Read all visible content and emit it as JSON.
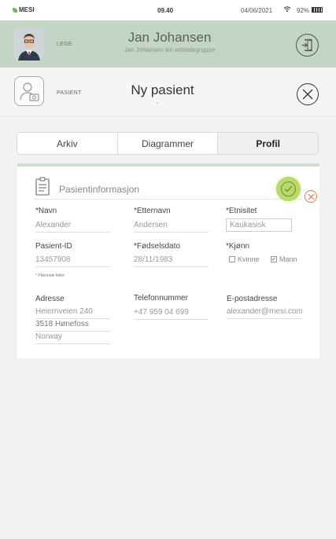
{
  "status": {
    "brand": "MESI",
    "time": "09.40",
    "date": "04/06/2021",
    "battery": "92%"
  },
  "doctor": {
    "role": "LEGE",
    "name": "Jan Johansen",
    "group": "Jan Johansen sin arbeidsgruppe"
  },
  "patient": {
    "role": "PASIENT",
    "title": "Ny pasient"
  },
  "tabs": [
    {
      "label": "Arkiv"
    },
    {
      "label": "Diagrammer"
    },
    {
      "label": "Profil",
      "active": true
    }
  ],
  "card": {
    "title": "Pasientinformasjon",
    "fields": {
      "first_name": {
        "label": "*Navn",
        "value": "Alexander"
      },
      "last_name": {
        "label": "*Etternavn",
        "value": "Andersen"
      },
      "ethnicity": {
        "label": "*Etnisitet",
        "value": "Kaukasisk"
      },
      "patient_id": {
        "label": "Pasient-ID",
        "value": "13457908"
      },
      "birth_date": {
        "label": "*Fødselsdato",
        "value": "28/11/1983"
      },
      "gender": {
        "label": "*Kjønn",
        "options": [
          "Kvinne",
          "Mann"
        ],
        "selected": "Mann"
      },
      "address": {
        "label": "Adresse",
        "line1": "Heiernveien 240",
        "line2": "3518  Hønefoss",
        "line3": "Norway"
      },
      "phone": {
        "label": "Telefonnummer",
        "value": "+47 959 04 699"
      },
      "email": {
        "label": "E-postadresse",
        "value": "alexander@mesi.com"
      }
    },
    "required_note": "* Påkrevde felter"
  },
  "colors": {
    "header_bg": "#c4d4c5",
    "confirm": "#b9d96a",
    "cancel": "#e07a45",
    "brand_green": "#74b749"
  }
}
